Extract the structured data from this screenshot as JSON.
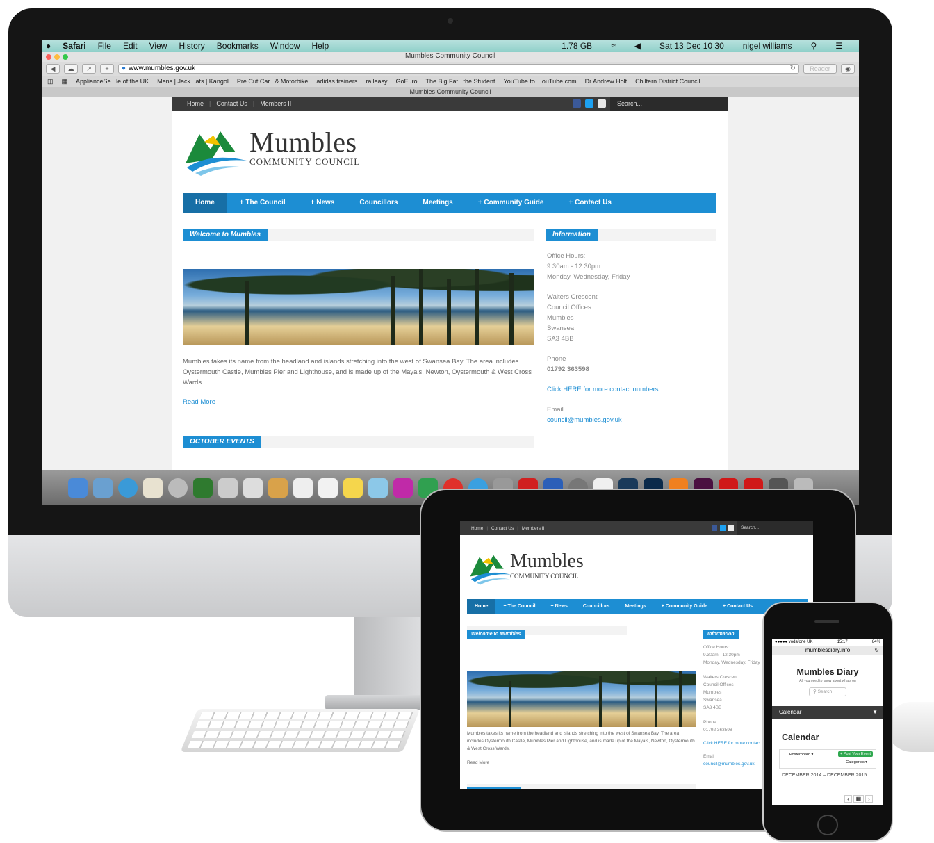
{
  "menubar": {
    "app": "Safari",
    "items": [
      "File",
      "Edit",
      "View",
      "History",
      "Bookmarks",
      "Window",
      "Help"
    ],
    "memory": "1.78 GB",
    "clock": "Sat 13 Dec 10 30",
    "user": "nigel williams"
  },
  "window": {
    "title": "Mumbles Community Council",
    "tab": "Mumbles Community Council"
  },
  "toolbar": {
    "url": "www.mumbles.gov.uk",
    "reader": "Reader"
  },
  "bookmarks": [
    "ApplianceSe...le of the UK",
    "Mens | Jack...ats | Kangol",
    "Pre Cut Car...& Motorbike",
    "adidas trainers",
    "raileasy",
    "GoEuro",
    "The Big Fat...the Student",
    "YouTube to ...ouTube.com",
    "Dr Andrew Holt",
    "Chiltern District Council"
  ],
  "site": {
    "topnav": [
      "Home",
      "Contact Us",
      "Members II"
    ],
    "search_placeholder": "Search...",
    "logo": {
      "name": "Mumbles",
      "sub": "COMMUNITY  COUNCIL"
    },
    "nav": [
      "Home",
      "+ The Council",
      "+ News",
      "Councillors",
      "Meetings",
      "+ Community Guide",
      "+ Contact Us"
    ],
    "welcome_tag": "Welcome to Mumbles",
    "intro": "Mumbles takes its name from the headland and islands stretching into the west of Swansea Bay. The area includes Oystermouth Castle, Mumbles Pier and Lighthouse, and is made up of the Mayals, Newton, Oystermouth & West Cross Wards.",
    "read_more": "Read More",
    "events_tag": "OCTOBER EVENTS",
    "info_tag": "Information",
    "info": {
      "hours_label": "Office Hours:",
      "hours": "9.30am - 12.30pm",
      "days": "Monday, Wednesday, Friday",
      "address": [
        "Walters Crescent",
        "Council Offices",
        "Mumbles",
        "Swansea",
        "SA3 4BB"
      ],
      "phone_label": "Phone",
      "phone": "01792 363598",
      "contact_link": "Click HERE for more contact numbers",
      "email_label": "Email",
      "email": "council@mumbles.gov.uk"
    }
  },
  "ipad": {
    "address_short": [
      "Walters Crescent",
      "Council Offices",
      "Mumbles",
      "Swansea",
      "SA3 4BB"
    ],
    "contact_link": "Click HERE for more contact"
  },
  "iphone": {
    "carrier": "●●●●● vodafone UK",
    "time": "15:17",
    "battery": "84%",
    "url": "mumblesdiary.info",
    "title": "Mumbles Diary",
    "subtitle": "All you need to know about whats on",
    "search": "Search",
    "bar": "Calendar",
    "heading": "Calendar",
    "posterboard": "Posterboard ▾",
    "post_event": "+ Post Your Event",
    "categories": "Categories ▾",
    "range": "DECEMBER 2014 – DECEMBER 2015"
  },
  "colors": {
    "brand_blue": "#1d8ed3",
    "dark_bar": "#3a3a3a"
  }
}
